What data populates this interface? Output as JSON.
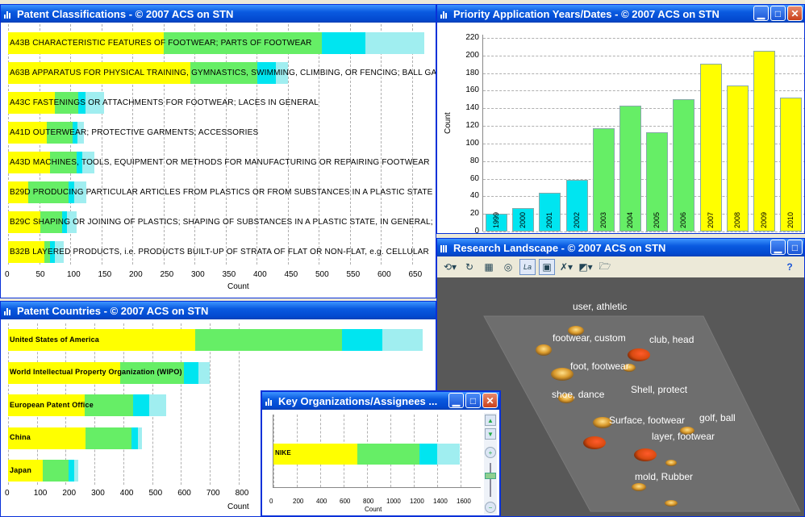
{
  "colors": {
    "yellow": "#ffff00",
    "green": "#66ee66",
    "cyan": "#00e5f0",
    "lightcyan": "#a0eef0"
  },
  "classifications": {
    "title": "Patent Classifications - © 2007 ACS on STN",
    "axis_label": "Count",
    "ticks": [
      "0",
      "50",
      "100",
      "150",
      "200",
      "250",
      "300",
      "350",
      "400",
      "450",
      "500",
      "550",
      "600",
      "650"
    ],
    "rows": [
      {
        "label": "A43B  CHARACTERISTIC FEATURES OF FOOTWEAR; PARTS OF FOOTWEAR",
        "segs": [
          250,
          255,
          70,
          95
        ]
      },
      {
        "label": "A63B APPARATUS FOR PHYSICAL TRAINING, GYMNASTICS, SWIMMING, CLIMBING, OR FENCING; BALL GA",
        "segs": [
          293,
          108,
          30,
          20
        ]
      },
      {
        "label": "A43C  FASTENINGS OR ATTACHMENTS FOR FOOTWEAR; LACES IN GENERAL",
        "segs": [
          75,
          38,
          12,
          30
        ]
      },
      {
        "label": "A41D OUTERWEAR; PROTECTIVE GARMENTS; ACCESSORIES",
        "segs": [
          62,
          42,
          8,
          10
        ]
      },
      {
        "label": "A43D MACHINES, TOOLS, EQUIPMENT OR METHODS FOR MANUFACTURING OR REPAIRING FOOTWEAR",
        "segs": [
          68,
          43,
          8,
          20
        ]
      },
      {
        "label": "B29D PRODUCING PARTICULAR ARTICLES FROM PLASTICS OR FROM SUBSTANCES IN A PLASTIC STATE",
        "segs": [
          33,
          65,
          8,
          20
        ]
      },
      {
        "label": "B29C SHAPING OR JOINING OF PLASTICS; SHAPING OF SUBSTANCES IN A PLASTIC STATE, IN GENERAL;",
        "segs": [
          52,
          35,
          8,
          15
        ]
      },
      {
        "label": "B32B LAYERED PRODUCTS, i.e. PRODUCTS BUILT-UP OF STRATA OF FLAT OR NON-FLAT, e.g. CELLULAR",
        "segs": [
          58,
          10,
          7,
          15
        ]
      }
    ]
  },
  "priority": {
    "title": "Priority Application Years/Dates - © 2007 ACS on STN",
    "axis_label": "Count",
    "yticks": [
      "0",
      "20",
      "40",
      "60",
      "80",
      "100",
      "120",
      "140",
      "160",
      "180",
      "200",
      "220"
    ],
    "bars": [
      {
        "year": "1999",
        "value": 20,
        "color": "#00e5f0"
      },
      {
        "year": "2000",
        "value": 27,
        "color": "#00e5f0"
      },
      {
        "year": "2001",
        "value": 44,
        "color": "#00e5f0"
      },
      {
        "year": "2002",
        "value": 59,
        "color": "#00e5f0"
      },
      {
        "year": "2003",
        "value": 117,
        "color": "#66ee66"
      },
      {
        "year": "2004",
        "value": 143,
        "color": "#66ee66"
      },
      {
        "year": "2005",
        "value": 113,
        "color": "#66ee66"
      },
      {
        "year": "2006",
        "value": 150,
        "color": "#66ee66"
      },
      {
        "year": "2007",
        "value": 191,
        "color": "#ffff00"
      },
      {
        "year": "2008",
        "value": 166,
        "color": "#ffff00"
      },
      {
        "year": "2009",
        "value": 205,
        "color": "#ffff00"
      },
      {
        "year": "2010",
        "value": 152,
        "color": "#ffff00"
      }
    ]
  },
  "countries": {
    "title": "Patent Countries - © 2007 ACS on STN",
    "axis_label": "Count",
    "ticks": [
      "0",
      "100",
      "200",
      "300",
      "400",
      "500",
      "600",
      "700",
      "800"
    ],
    "rows": [
      {
        "label": "United States of America",
        "segs": [
          650,
          510,
          140,
          140
        ]
      },
      {
        "label": "World Intellectual Property Organization (WIPO)",
        "segs": [
          390,
          220,
          50,
          40
        ]
      },
      {
        "label": "European Patent Office",
        "segs": [
          265,
          170,
          55,
          60
        ]
      },
      {
        "label": "China",
        "segs": [
          270,
          160,
          20,
          15
        ]
      },
      {
        "label": "Japan",
        "segs": [
          120,
          90,
          20,
          15
        ]
      }
    ]
  },
  "organizations": {
    "title": "Key Organizations/Assignees ...",
    "axis_label": "Count",
    "ticks": [
      "0",
      "200",
      "400",
      "600",
      "800",
      "1000",
      "1200",
      "1400",
      "1600"
    ],
    "rows": [
      {
        "label": "NIKE",
        "segs": [
          720,
          530,
          150,
          190
        ]
      }
    ]
  },
  "landscape": {
    "title": "Research Landscape - © 2007 ACS on STN",
    "labels": [
      "user, athletic",
      "footwear, custom",
      "club, head",
      "foot, footwear",
      "shoe, dance",
      "Shell, protect",
      "Surface, footwear",
      "golf, ball",
      "layer, footwear",
      "mold, Rubber"
    ]
  }
}
